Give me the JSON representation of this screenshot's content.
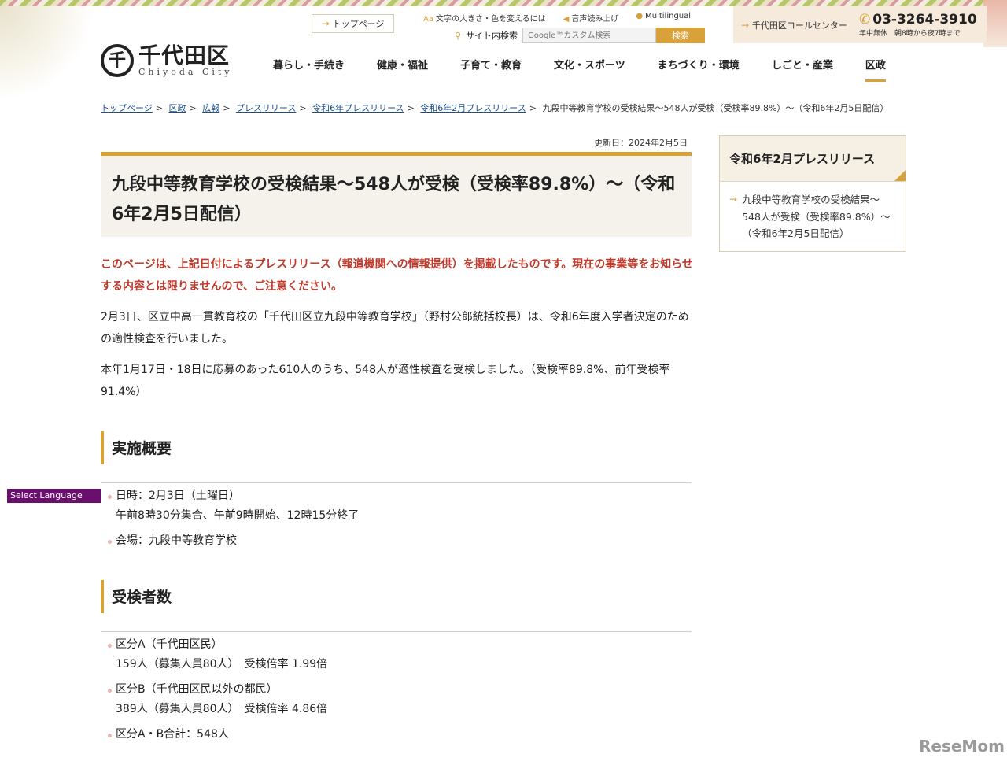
{
  "header": {
    "logo_mark": "千",
    "logo_name": "千代田区",
    "logo_en": "Chiyoda City",
    "top_page_label": "トップページ",
    "util_fontsize": "文字の大きさ・色を変えるには",
    "util_voice": "音声読み上げ",
    "util_multilingual": "Multilingual",
    "search_label": "サイト内検索",
    "search_placeholder": "Google™カスタム検索",
    "search_button": "検索",
    "call_center_label": "千代田区コールセンター",
    "call_phone": "03-3264-3910",
    "call_hours": "年中無休　朝8時から夜7時まで"
  },
  "nav": {
    "items": [
      {
        "label": "暮らし・手続き"
      },
      {
        "label": "健康・福祉"
      },
      {
        "label": "子育て・教育"
      },
      {
        "label": "文化・スポーツ"
      },
      {
        "label": "まちづくり・環境"
      },
      {
        "label": "しごと・産業"
      },
      {
        "label": "区政"
      }
    ]
  },
  "breadcrumb": {
    "items": [
      "トップページ",
      "区政",
      "広報",
      "プレスリリース",
      "令和6年プレスリリース",
      "令和6年2月プレスリリース"
    ],
    "current": "九段中等教育学校の受検結果〜548人が受検（受検率89.8%）〜（令和6年2月5日配信）",
    "sep": ">"
  },
  "main": {
    "updated": "更新日：2024年2月5日",
    "title": "九段中等教育学校の受検結果〜548人が受検（受検率89.8%）〜（令和6年2月5日配信）",
    "notice": "このページは、上記日付によるプレスリリース（報道機関への情報提供）を掲載したものです。現在の事業等をお知らせする内容とは限りませんので、ご注意ください。",
    "para1": "2月3日、区立中高一貫教育校の「千代田区立九段中等教育学校」（野村公郎統括校長）は、令和6年度入学者決定のための適性検査を行いました。",
    "para2": "本年1月17日・18日に応募のあった610人のうち、548人が適性検査を受検しました。（受検率89.8%、前年受検率91.4%）",
    "section1": {
      "heading": "実施概要",
      "items": [
        {
          "line1": "日時：2月3日（土曜日）",
          "line2": "午前8時30分集合、午前9時開始、12時15分終了"
        },
        {
          "line1": "会場：九段中等教育学校",
          "line2": ""
        }
      ]
    },
    "section2": {
      "heading": "受検者数",
      "items": [
        {
          "line1": "区分A（千代田区民）",
          "line2": "159人（募集人員80人）　受検倍率 1.99倍"
        },
        {
          "line1": "区分B（千代田区民以外の都民）",
          "line2": "389人（募集人員80人）　受検倍率 4.86倍"
        },
        {
          "line1": "区分A・B合計：548人",
          "line2": ""
        }
      ]
    }
  },
  "sidebar": {
    "heading": "令和6年2月プレスリリース",
    "link": "九段中等教育学校の受検結果〜548人が受検（受検率89.8%）〜（令和6年2月5日配信）"
  },
  "language_button": "Select Language",
  "watermark": "ReseMom",
  "colors": {
    "accent": "#d9a13a",
    "notice_red": "#c0392b",
    "link_blue": "#1a4f8c",
    "lang_purple": "#6a0f6e"
  }
}
